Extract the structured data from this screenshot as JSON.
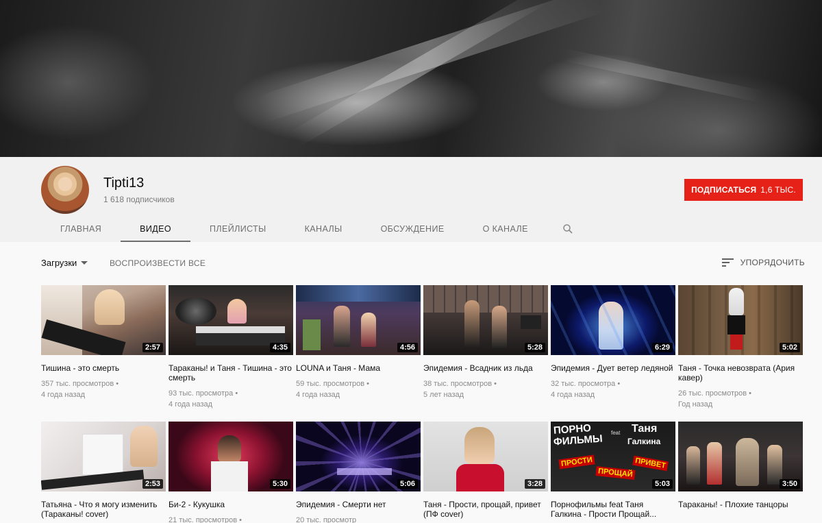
{
  "channel": {
    "name": "Tipti13",
    "subscribers": "1 618 подписчиков",
    "subscribe_label": "ПОДПИСАТЬСЯ",
    "subscribe_count": "1,6 ТЫС."
  },
  "tabs": [
    {
      "label": "ГЛАВНАЯ"
    },
    {
      "label": "ВИДЕО"
    },
    {
      "label": "ПЛЕЙЛИСТЫ"
    },
    {
      "label": "КАНАЛЫ"
    },
    {
      "label": "ОБСУЖДЕНИЕ"
    },
    {
      "label": "О КАНАЛЕ"
    }
  ],
  "active_tab": "ВИДЕО",
  "toolbar": {
    "uploads": "Загрузки",
    "play_all": "ВОСПРОИЗВЕСТИ ВСЕ",
    "sort": "УПОРЯДОЧИТЬ"
  },
  "videos": [
    {
      "title": "Тишина - это смерть",
      "views": "357 тыс. просмотров",
      "age": "4 года назад",
      "duration": "2:57"
    },
    {
      "title": "Тараканы! и Таня - Тишина - это смерть",
      "views": "93 тыс. просмотра",
      "age": "4 года назад",
      "duration": "4:35"
    },
    {
      "title": "LOUNA и Таня - Мама",
      "views": "59 тыс. просмотров",
      "age": "4 года назад",
      "duration": "4:56"
    },
    {
      "title": "Эпидемия - Всадник из льда",
      "views": "38 тыс. просмотров",
      "age": "5 лет назад",
      "duration": "5:28"
    },
    {
      "title": "Эпидемия - Дует ветер ледяной",
      "views": "32 тыс. просмотра",
      "age": "4 года назад",
      "duration": "6:29"
    },
    {
      "title": "Таня - Точка невозврата (Ария кавер)",
      "views": "26 тыс. просмотров",
      "age": "Год назад",
      "duration": "5:02"
    },
    {
      "title": "Татьяна - Что я могу изменить (Тараканы! cover)",
      "views": "",
      "age": "",
      "duration": "2:53"
    },
    {
      "title": "Би-2 - Кукушка",
      "views": "21 тыс. просмотров",
      "age": "",
      "duration": "5:30"
    },
    {
      "title": "Эпидемия - Смерти нет",
      "views": "20 тыс. просмотр",
      "age": "",
      "duration": "5:06"
    },
    {
      "title": "Таня - Прости, прощай, привет (ПФ cover)",
      "views": "",
      "age": "",
      "duration": "3:28"
    },
    {
      "title": "Порнофильмы feat Таня Галкина - Прости Прощай...",
      "views": "",
      "age": "",
      "duration": "5:03"
    },
    {
      "title": "Тараканы! - Плохие танцоры",
      "views": "",
      "age": "",
      "duration": "3:50"
    }
  ],
  "thumb_text": {
    "line1": "ПОРНО",
    "line2": "ФИЛЬМЫ",
    "feat": "feat",
    "name1": "Таня",
    "name2": "Галкина",
    "words": [
      "ПРОСТИ",
      "ПРОЩАЙ",
      "ПРИВЕТ"
    ]
  },
  "icons": {
    "dropdown": "caret-down-icon",
    "sort": "sort-lines-icon",
    "search": "search-icon",
    "dot_menu": "more-dots-icon"
  },
  "colors": {
    "subscribe": "#e62117",
    "header_bg": "#f1f1f1",
    "page_bg": "#f9f9f9"
  }
}
